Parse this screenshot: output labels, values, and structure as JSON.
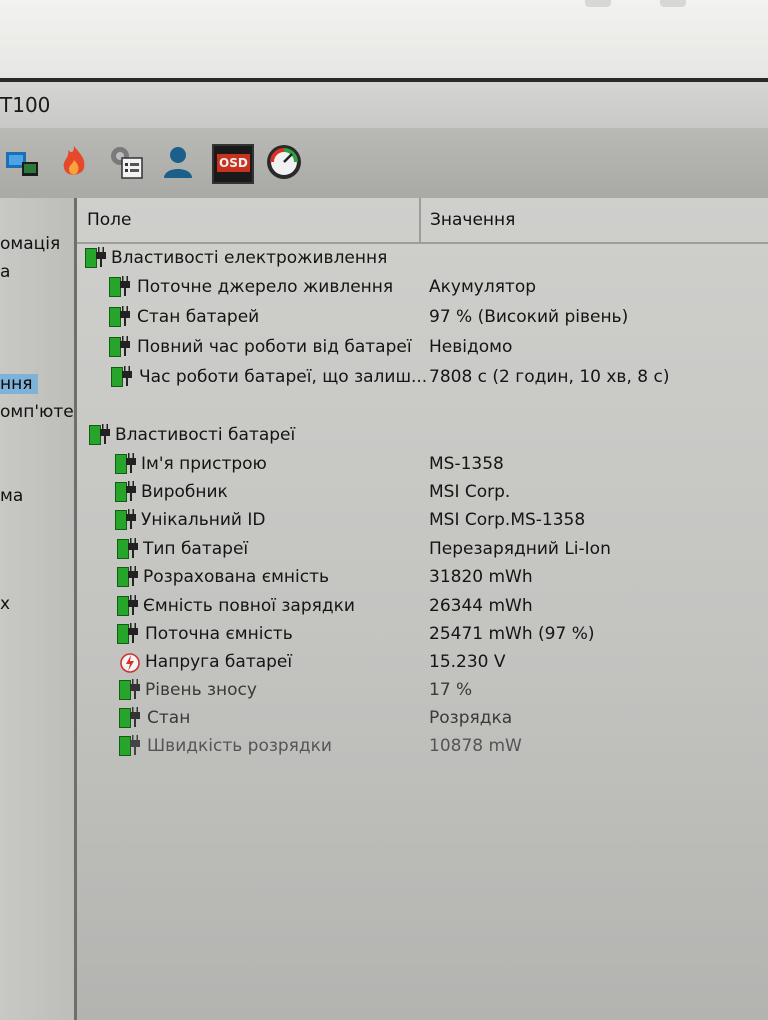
{
  "window": {
    "title_fragment": "T100"
  },
  "toolbar": {
    "icons": [
      "network-icon",
      "flame-icon",
      "scheduler-icon",
      "user-icon",
      "osd-icon",
      "gauge-icon"
    ],
    "osd_label": "OSD"
  },
  "left_panel": {
    "items": [
      "омація",
      "а",
      "ння",
      "омп'юте",
      "ма",
      "х"
    ]
  },
  "columns": {
    "field": "Поле",
    "value": "Значення"
  },
  "power_section": {
    "title": "Властивості електроживлення",
    "rows": [
      {
        "field": "Поточне джерело живлення",
        "value": "Акумулятор"
      },
      {
        "field": "Стан батарей",
        "value": "97 % (Високий рівень)"
      },
      {
        "field": "Повний час роботи від батареї",
        "value": "Невідомо"
      },
      {
        "field": "Час роботи батареї, що залиш...",
        "value": "7808 с (2 годин, 10 хв, 8 с)"
      }
    ]
  },
  "battery_section": {
    "title": "Властивості батареї",
    "rows": [
      {
        "field": "Ім'я пристрою",
        "value": "MS-1358"
      },
      {
        "field": "Виробник",
        "value": "MSI Corp."
      },
      {
        "field": "Унікальний ID",
        "value": "MSI Corp.MS-1358"
      },
      {
        "field": "Тип батареї",
        "value": "Перезарядний Li-Ion"
      },
      {
        "field": "Розрахована ємність",
        "value": "31820 mWh"
      },
      {
        "field": "Ємність повної зарядки",
        "value": "26344 mWh"
      },
      {
        "field": "Поточна ємність",
        "value": "25471 mWh  (97 %)"
      },
      {
        "field": "Напруга батареї",
        "value": "15.230 V"
      },
      {
        "field": "Рівень зносу",
        "value": "17 %"
      },
      {
        "field": "Стан",
        "value": "Розрядка"
      },
      {
        "field": "Швидкість розрядки",
        "value": "10878 mW"
      }
    ]
  }
}
